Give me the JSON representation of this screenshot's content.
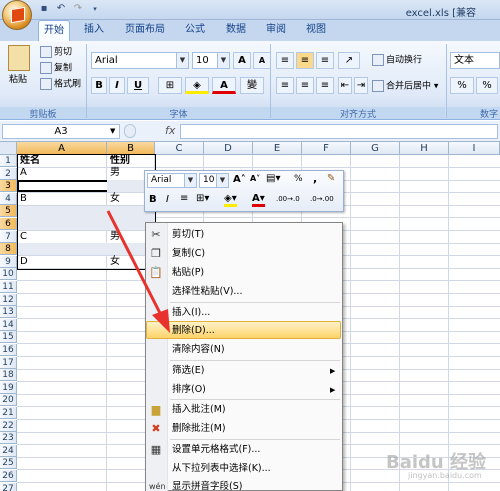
{
  "window": {
    "title": "excel.xls [兼容"
  },
  "quick_access": {
    "save_icon": "save-icon",
    "undo_icon": "undo-icon",
    "redo_icon": "redo-icon"
  },
  "tabs": [
    {
      "label": "开始",
      "active": true
    },
    {
      "label": "插入"
    },
    {
      "label": "页面布局"
    },
    {
      "label": "公式"
    },
    {
      "label": "数据"
    },
    {
      "label": "审阅"
    },
    {
      "label": "视图"
    }
  ],
  "ribbon": {
    "clipboard": {
      "paste": "粘贴",
      "cut": "剪切",
      "copy": "复制",
      "format_painter": "格式刷",
      "group_label": "剪贴板"
    },
    "font": {
      "font_name": "Arial",
      "font_size": "10",
      "bold": "B",
      "italic": "I",
      "underline": "U",
      "grow": "A",
      "shrink": "A",
      "phonetic": "變",
      "group_label": "字体"
    },
    "alignment": {
      "wrap_text": "自动换行",
      "merge_center": "合并后居中",
      "group_label": "对齐方式"
    },
    "number": {
      "format": "文本",
      "group_label": "数字"
    }
  },
  "formula_bar": {
    "name_box": "A3",
    "fx": "fx",
    "value": ""
  },
  "sheet": {
    "columns": [
      "A",
      "B",
      "C",
      "D",
      "E",
      "F",
      "G",
      "H",
      "I"
    ],
    "rows": [
      "1",
      "2",
      "3",
      "4",
      "5",
      "6",
      "7",
      "8",
      "9",
      "10",
      "11",
      "12",
      "13",
      "14",
      "15",
      "16",
      "17",
      "18",
      "19",
      "20",
      "21",
      "22",
      "23",
      "24",
      "25",
      "26",
      "27"
    ],
    "cells": {
      "A1": "姓名",
      "B1": "性别",
      "A2": "A",
      "B2": "男",
      "A4": "B",
      "B4": "女",
      "A7": "C",
      "B7": "男",
      "A9": "D",
      "B9": "女"
    }
  },
  "mini_toolbar": {
    "font_name": "Arial",
    "font_size": "10",
    "percent": "%",
    "comma": ",",
    "bold": "B",
    "italic": "I",
    "inc_decimal": ".00→.0",
    "dec_decimal": ".0→.00"
  },
  "context_menu": {
    "items": [
      {
        "label": "剪切(T)",
        "icon": "scissors-icon"
      },
      {
        "label": "复制(C)",
        "icon": "copy-icon"
      },
      {
        "label": "粘贴(P)",
        "icon": "paste-icon"
      },
      {
        "label": "选择性粘贴(V)..."
      },
      {
        "label": "插入(I)..."
      },
      {
        "label": "删除(D)...",
        "highlighted": true
      },
      {
        "label": "清除内容(N)"
      },
      {
        "label": "筛选(E)",
        "submenu": true
      },
      {
        "label": "排序(O)",
        "submenu": true
      },
      {
        "label": "插入批注(M)",
        "icon": "insert-comment-icon"
      },
      {
        "label": "删除批注(M)",
        "icon": "delete-comment-icon"
      },
      {
        "label": "设置单元格格式(F)...",
        "icon": "format-cells-icon"
      },
      {
        "label": "从下拉列表中选择(K)..."
      },
      {
        "label": "显示拼音字段(S)",
        "icon": "phonetic-icon"
      }
    ]
  },
  "watermark": {
    "text": "Baidu 经验",
    "sub": "jingyan.baidu.com"
  },
  "colors": {
    "accent": "#15428b",
    "highlight": "#fdd36a",
    "arrow": "#e8322e"
  }
}
